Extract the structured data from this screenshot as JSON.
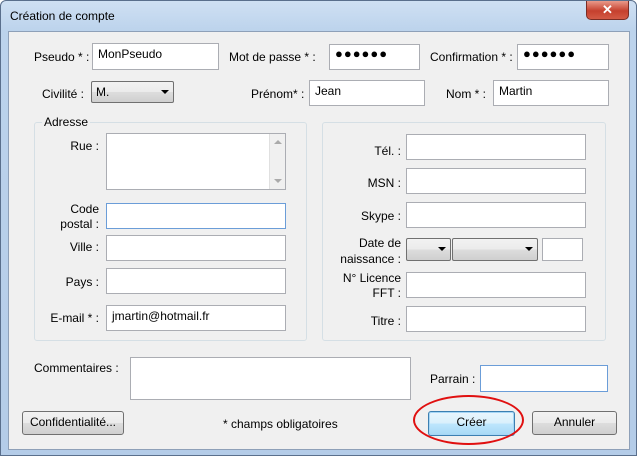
{
  "window": {
    "title": "Création de compte",
    "close_glyph": "✕"
  },
  "row1": {
    "pseudo": {
      "label": "Pseudo * :",
      "value": "MonPseudo"
    },
    "password": {
      "label": "Mot de passe * :",
      "value": "●●●●●●"
    },
    "confirmation": {
      "label": "Confirmation * :",
      "value": "●●●●●●"
    }
  },
  "row2": {
    "civilite": {
      "label": "Civilité :",
      "value": "M."
    },
    "prenom": {
      "label": "Prénom* :",
      "value": "Jean"
    },
    "nom": {
      "label": "Nom * :",
      "value": "Martin"
    }
  },
  "address": {
    "title": "Adresse",
    "rue": {
      "label": "Rue :",
      "value": ""
    },
    "code_postal": {
      "label_line1": "Code",
      "label_line2": "postal :",
      "value": ""
    },
    "ville": {
      "label": "Ville :",
      "value": ""
    },
    "pays": {
      "label": "Pays :",
      "value": ""
    },
    "email": {
      "label": "E-mail * :",
      "value": "jmartin@hotmail.fr"
    }
  },
  "contact": {
    "tel": {
      "label": "Tél. :",
      "value": ""
    },
    "msn": {
      "label": "MSN :",
      "value": ""
    },
    "skype": {
      "label": "Skype :",
      "value": ""
    },
    "naissance": {
      "label_line1": "Date de",
      "label_line2": "naissance :",
      "day": "",
      "month": "",
      "year": ""
    },
    "licence": {
      "label_line1": "N° Licence",
      "label_line2": "FFT :",
      "value": ""
    },
    "titre": {
      "label": "Titre :",
      "value": ""
    }
  },
  "commentaires": {
    "label": "Commentaires :",
    "value": ""
  },
  "parrain": {
    "label": "Parrain :",
    "value": ""
  },
  "footer": {
    "confidentialite_label": "Confidentialité...",
    "required_note": "* champs obligatoires",
    "create_label": "Créer",
    "cancel_label": "Annuler"
  },
  "colors": {
    "highlight": "#e01010",
    "titlebar": "#bcd3ec",
    "client_bg": "#f0f0f0"
  }
}
